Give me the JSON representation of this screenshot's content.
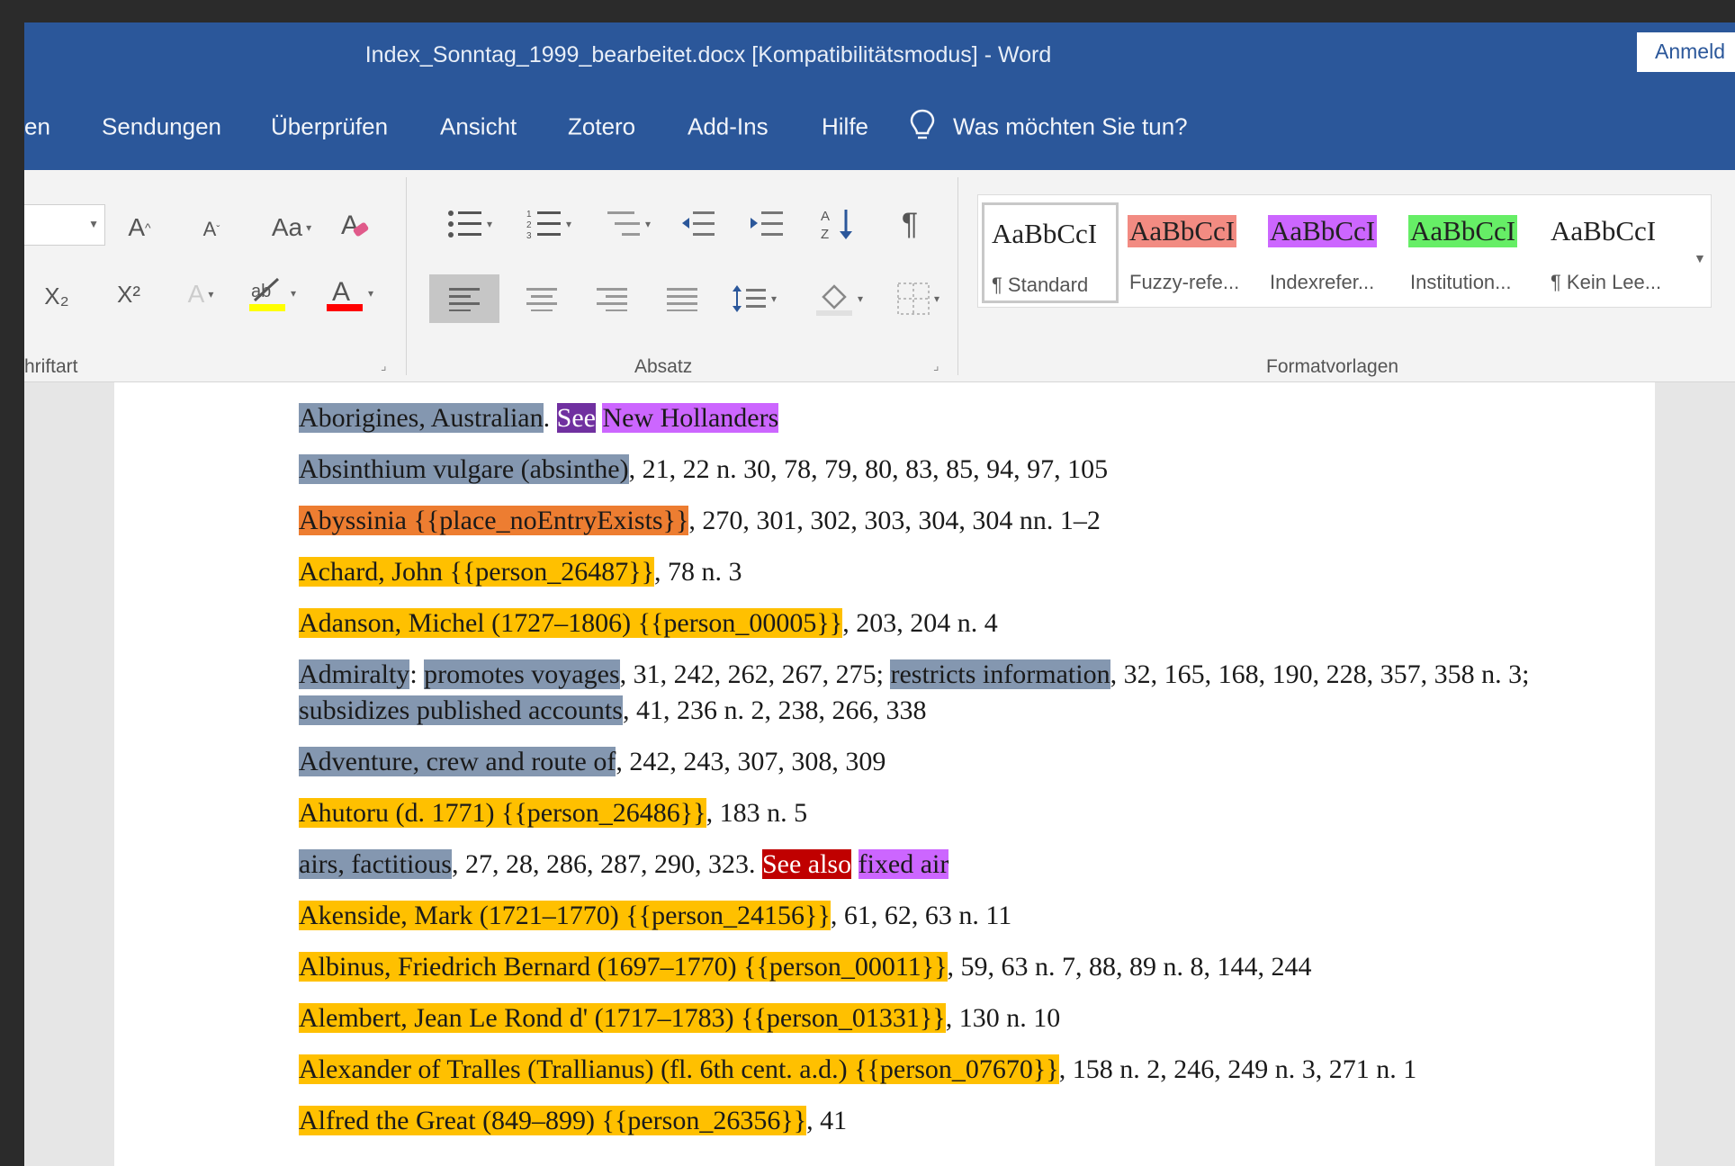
{
  "window": {
    "title": "Index_Sonntag_1999_bearbeitet.docx [Kompatibilitätsmodus]  -  Word",
    "signin": "Anmeld"
  },
  "tabs": [
    "en",
    "Sendungen",
    "Überprüfen",
    "Ansicht",
    "Zotero",
    "Add-Ins",
    "Hilfe"
  ],
  "tellme": {
    "icon": "lightbulb-icon",
    "label": "Was möchten Sie tun?"
  },
  "ribbon": {
    "font_group": {
      "label": "hriftart",
      "grow_font": "A",
      "shrink_font": "A",
      "change_case": "Aa",
      "subscript": "X₂",
      "superscript": "X²",
      "font_color_letter": "A",
      "highlight_colors": {
        "highlight": "#ffff00",
        "font_color": "#ff0000"
      }
    },
    "paragraph_group": {
      "label": "Absatz"
    },
    "styles_group": {
      "label": "Formatvorlagen",
      "styles": [
        {
          "sample": "AaBbCcI",
          "name": "¶ Standard",
          "highlight": "",
          "selected": true
        },
        {
          "sample": "AaBbCcI",
          "name": "Fuzzy-refe...",
          "highlight": "#f28b82",
          "selected": false
        },
        {
          "sample": "AaBbCcI",
          "name": "Indexrefer...",
          "highlight": "#cc66ff",
          "selected": false
        },
        {
          "sample": "AaBbCcI",
          "name": "Institution...",
          "highlight": "#66ee66",
          "selected": false
        },
        {
          "sample": "AaBbCcI",
          "name": "¶ Kein Lee...",
          "highlight": "",
          "selected": false
        }
      ]
    }
  },
  "highlight_colors": {
    "grey": "#8497b0",
    "orange": "#ed7d31",
    "yellow": "#ffc000",
    "see": "#7030a0",
    "see_also": "#c00000",
    "violet": "#cc66ff"
  },
  "entries": [
    [
      {
        "text": "Aborigines, Australian",
        "hl": "grey"
      },
      {
        "text": ". "
      },
      {
        "text": "See",
        "hl": "see"
      },
      {
        "text": " "
      },
      {
        "text": "New Hollanders",
        "hl": "violet"
      }
    ],
    [
      {
        "text": "Absinthium vulgare (absinthe)",
        "hl": "grey"
      },
      {
        "text": ", 21, 22 n. 30, 78, 79, 80, 83, 85, 94, 97, 105"
      }
    ],
    [
      {
        "text": "Abyssinia {{place_noEntryExists}}",
        "hl": "orange"
      },
      {
        "text": ", 270, 301, 302, 303, 304, 304 nn. 1–2"
      }
    ],
    [
      {
        "text": "Achard, John {{person_26487}}",
        "hl": "yellow"
      },
      {
        "text": ", 78 n. 3"
      }
    ],
    [
      {
        "text": "Adanson, Michel (1727–1806) {{person_00005}}",
        "hl": "yellow"
      },
      {
        "text": ", 203, 204 n. 4"
      }
    ],
    [
      {
        "text": "Admiralty",
        "hl": "grey"
      },
      {
        "text": ": "
      },
      {
        "text": "promotes voyages",
        "hl": "grey"
      },
      {
        "text": ", 31, 242, 262, 267, 275; "
      },
      {
        "text": "restricts information",
        "hl": "grey"
      },
      {
        "text": ", 32, 165, 168, 190, 228, 357, 358 n. 3; "
      },
      {
        "text": "subsidizes published accounts",
        "hl": "grey"
      },
      {
        "text": ", 41, 236 n. 2, 238, 266, 338"
      }
    ],
    [
      {
        "text": "Adventure, crew and route of",
        "hl": "grey"
      },
      {
        "text": ", 242, 243, 307, 308, 309"
      }
    ],
    [
      {
        "text": "Ahutoru (d. 1771) {{person_26486}}",
        "hl": "yellow"
      },
      {
        "text": ", 183 n. 5"
      }
    ],
    [
      {
        "text": "airs, factitious",
        "hl": "grey"
      },
      {
        "text": ", 27, 28, 286, 287, 290, 323. "
      },
      {
        "text": "See also",
        "hl": "see_also"
      },
      {
        "text": " "
      },
      {
        "text": "fixed air",
        "hl": "violet"
      }
    ],
    [
      {
        "text": "Akenside, Mark (1721–1770) {{person_24156}}",
        "hl": "yellow"
      },
      {
        "text": ", 61, 62, 63 n. 11"
      }
    ],
    [
      {
        "text": "Albinus, Friedrich Bernard (1697–1770) {{person_00011}}",
        "hl": "yellow"
      },
      {
        "text": ", 59, 63 n. 7, 88, 89 n. 8, 144, 244"
      }
    ],
    [
      {
        "text": "Alembert, Jean Le Rond d' (1717–1783) {{person_01331}}",
        "hl": "yellow"
      },
      {
        "text": ", 130 n. 10"
      }
    ],
    [
      {
        "text": "Alexander of Tralles (Trallianus) (fl. 6th cent. a.d.) {{person_07670}}",
        "hl": "yellow"
      },
      {
        "text": ", 158 n. 2, 246, 249 n. 3, 271 n. 1"
      }
    ],
    [
      {
        "text": "Alfred the Great (849–899) {{person_26356}}",
        "hl": "yellow"
      },
      {
        "text": ", 41"
      }
    ]
  ]
}
